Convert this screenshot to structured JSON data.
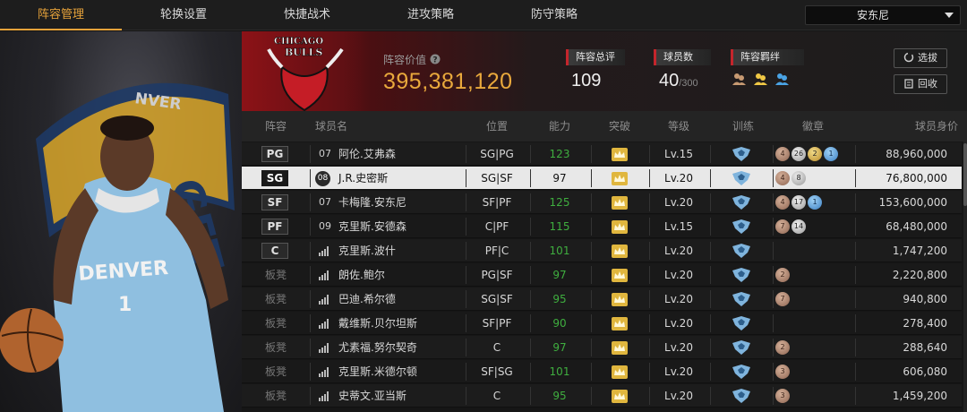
{
  "nav": {
    "tabs": [
      "阵容管理",
      "轮换设置",
      "快捷战术",
      "进攻策略",
      "防守策略"
    ],
    "active_tab": 0,
    "dropdown_value": "安东尼"
  },
  "player_card": {
    "team_text": "NVER",
    "jersey_text": "DENVER",
    "jersey_number": "1"
  },
  "team": {
    "logo_text_top": "CHICAGO",
    "logo_text_bottom": "BULLS",
    "value_label": "阵容价值",
    "value": "395,381,120",
    "rating_label": "阵容总评",
    "rating": "109",
    "count_label": "球员数",
    "count": "40",
    "count_max": "/300",
    "bond_label": "阵容羁绊",
    "select_button": "选拔",
    "recycle_button": "回收"
  },
  "table": {
    "headers": [
      "阵容",
      "球员名",
      "位置",
      "能力",
      "突破",
      "等级",
      "训练",
      "徽章",
      "球员身价"
    ],
    "rows": [
      {
        "slot": "PG",
        "jersey": "07",
        "name": "阿伦.艾弗森",
        "pos": "SG|PG",
        "ability": "123",
        "level": "Lv.15",
        "badges": [
          [
            "4",
            "bronze"
          ],
          [
            "26",
            "silver"
          ],
          [
            "2",
            "gold"
          ],
          [
            "1",
            "blue"
          ]
        ],
        "value": "88,960,000"
      },
      {
        "slot": "SG",
        "jersey": "08",
        "name": "J.R.史密斯",
        "pos": "SG|SF",
        "ability": "97",
        "level": "Lv.20",
        "badges": [
          [
            "4",
            "bronze"
          ],
          [
            "8",
            "silver"
          ]
        ],
        "value": "76,800,000"
      },
      {
        "slot": "SF",
        "jersey": "07",
        "name": "卡梅隆.安东尼",
        "pos": "SF|PF",
        "ability": "125",
        "level": "Lv.20",
        "badges": [
          [
            "4",
            "bronze"
          ],
          [
            "17",
            "silver"
          ],
          [
            "1",
            "blue"
          ]
        ],
        "value": "153,600,000"
      },
      {
        "slot": "PF",
        "jersey": "09",
        "name": "克里斯.安德森",
        "pos": "C|PF",
        "ability": "115",
        "level": "Lv.15",
        "badges": [
          [
            "7",
            "bronze"
          ],
          [
            "14",
            "silver"
          ]
        ],
        "value": "68,480,000"
      },
      {
        "slot": "C",
        "jersey": "",
        "name": "克里斯.波什",
        "pos": "PF|C",
        "ability": "101",
        "level": "Lv.20",
        "badges": [],
        "value": "1,747,200"
      },
      {
        "slot": "板凳",
        "jersey": "",
        "name": "朗佐.鲍尔",
        "pos": "PG|SF",
        "ability": "97",
        "level": "Lv.20",
        "badges": [
          [
            "2",
            "bronze"
          ]
        ],
        "value": "2,220,800"
      },
      {
        "slot": "板凳",
        "jersey": "",
        "name": "巴迪.希尔德",
        "pos": "SG|SF",
        "ability": "95",
        "level": "Lv.20",
        "badges": [
          [
            "7",
            "bronze"
          ]
        ],
        "value": "940,800"
      },
      {
        "slot": "板凳",
        "jersey": "",
        "name": "戴维斯.贝尔坦斯",
        "pos": "SF|PF",
        "ability": "90",
        "level": "Lv.20",
        "badges": [],
        "value": "278,400"
      },
      {
        "slot": "板凳",
        "jersey": "",
        "name": "尤素福.努尔契奇",
        "pos": "C",
        "ability": "97",
        "level": "Lv.20",
        "badges": [
          [
            "2",
            "bronze"
          ]
        ],
        "value": "288,640"
      },
      {
        "slot": "板凳",
        "jersey": "",
        "name": "克里斯.米德尔顿",
        "pos": "SF|SG",
        "ability": "101",
        "level": "Lv.20",
        "badges": [
          [
            "3",
            "bronze"
          ]
        ],
        "value": "606,080"
      },
      {
        "slot": "板凳",
        "jersey": "",
        "name": "史蒂文.亚当斯",
        "pos": "C",
        "ability": "95",
        "level": "Lv.20",
        "badges": [
          [
            "3",
            "bronze"
          ]
        ],
        "value": "1,459,200"
      }
    ],
    "selected_row": 1
  },
  "colors": {
    "accent": "#e6a23a",
    "ability_green": "#3fae3f",
    "bulls_red": "#8c1217"
  }
}
